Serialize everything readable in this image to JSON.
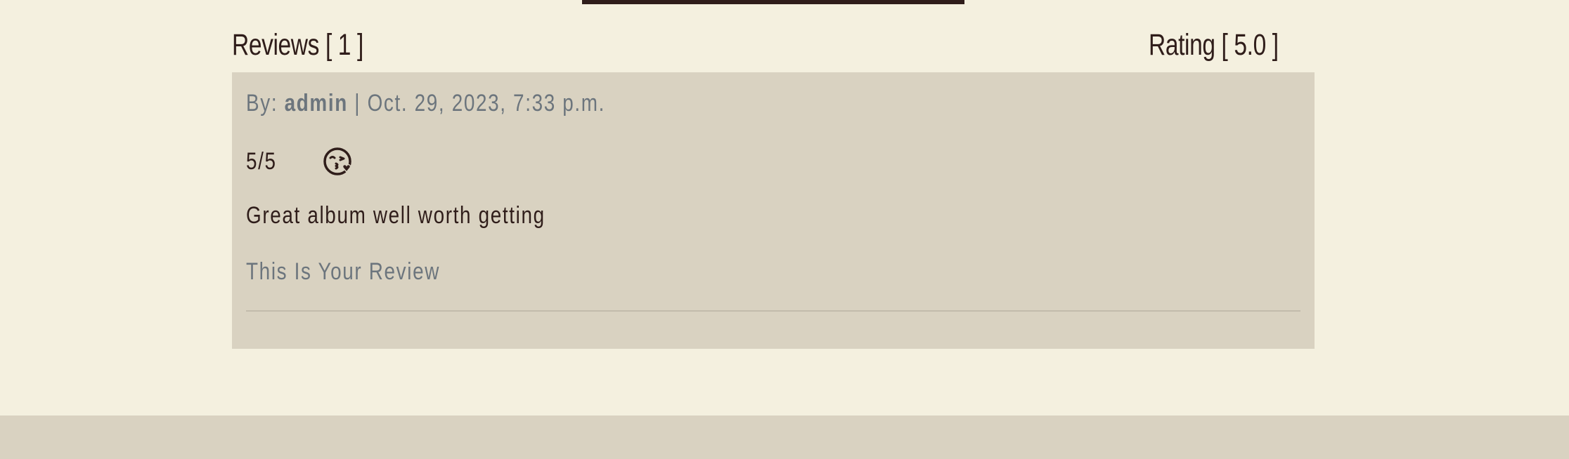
{
  "reviews_heading": {
    "label": "Reviews [ 1 ]"
  },
  "rating_heading": {
    "label": "Rating [ 5.0 ]"
  },
  "review": {
    "by_label": "By:",
    "author": "admin",
    "separator": "|",
    "date": "Oct. 29, 2023, 7:33 p.m.",
    "score": "5/5",
    "mood_icon": "kiss-heart-face-icon",
    "title": "Great album well worth getting",
    "body": "This Is Your Review"
  },
  "colors": {
    "background": "#f4f0df",
    "card": "#d9d2c1",
    "text_dark": "#2f1d1a",
    "text_muted": "#6c757d"
  }
}
